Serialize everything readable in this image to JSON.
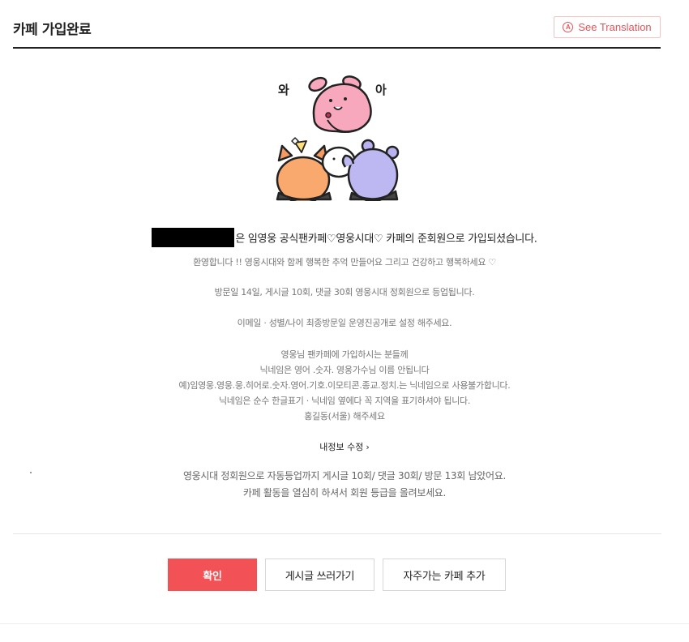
{
  "header": {
    "title": "카페 가입완료",
    "translate_label": "See Translation",
    "translate_icon": "translate-icon"
  },
  "mascot": {
    "left_text": "와",
    "right_text": "아"
  },
  "joined_message": "은 임영웅 공식팬카페♡영웅시대♡ 카페의 준회원으로 가입되셨습니다.",
  "welcome_lines": [
    "환영합니다 !! 영웅시대와 함께 행복한 추억 만들어요 그리고 건강하고 행복하세요 ♡",
    "방문일 14일, 게시글 10회, 댓글 30회 영웅시대 정회원으로 등업됩니다.",
    "이메일 · 성별/나이 최종방문일 운영진공개로 설정 해주세요.",
    "영웅님 팬카페에 가입하시는 분들께",
    "닉네임은 영어 .숫자. 영웅가수님 이름 안됩니다",
    "예)임영웅.영웅.웅.히어로.숫자.영어.기호.이모티콘.종교.정치.는 닉네임으로 사용불가합니다.",
    "닉네임은 순수 한글표기 · 닉네임 옆에다 꼭 지역을 표기하셔야 됩니다.",
    "홍길동(서울) 해주세요"
  ],
  "edit_profile_label": "내정보 수정",
  "auto_upgrade": {
    "line1": "영웅시대 정회원으로 자동등업까지 게시글 10회/ 댓글 30회/ 방문 13회 남았어요.",
    "line2": "카페 활동을 열심히 하셔서 회원 등급을 올려보세요."
  },
  "buttons": {
    "confirm": "확인",
    "write_post": "게시글 쓰러가기",
    "add_favorite": "자주가는 카페 추가"
  },
  "colors": {
    "accent": "#f25255",
    "translate": "#e8525a"
  }
}
